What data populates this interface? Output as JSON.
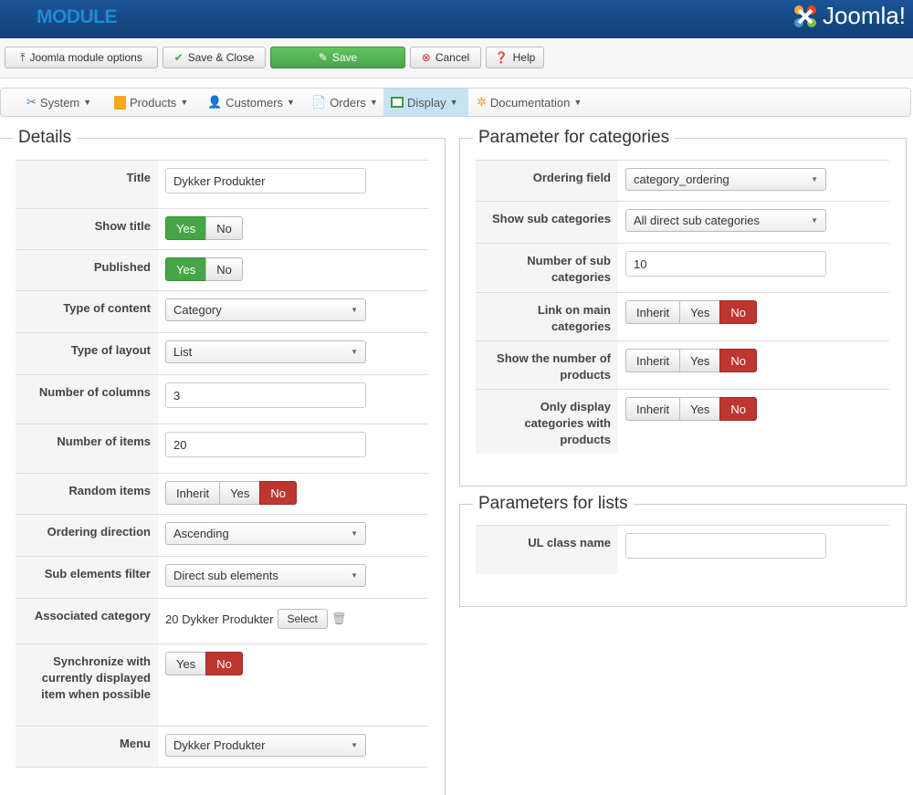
{
  "header": {
    "title": "MODULE",
    "logo": "Joomla!"
  },
  "toolbar": {
    "options": "Joomla module options",
    "save_close": "Save & Close",
    "save": "Save",
    "cancel": "Cancel",
    "help": "Help"
  },
  "menu": [
    {
      "label": "System",
      "icon": "tools-icon"
    },
    {
      "label": "Products",
      "icon": "box-icon"
    },
    {
      "label": "Customers",
      "icon": "users-icon"
    },
    {
      "label": "Orders",
      "icon": "document-icon"
    },
    {
      "label": "Display",
      "icon": "display-icon"
    },
    {
      "label": "Documentation",
      "icon": "help-ring-icon"
    }
  ],
  "details": {
    "legend": "Details",
    "title_label": "Title",
    "title_value": "Dykker Produkter",
    "show_title_label": "Show title",
    "published_label": "Published",
    "yes": "Yes",
    "no": "No",
    "inherit": "Inherit",
    "type_content_label": "Type of content",
    "type_content_value": "Category",
    "type_layout_label": "Type of layout",
    "type_layout_value": "List",
    "num_columns_label": "Number of columns",
    "num_columns_value": "3",
    "num_items_label": "Number of items",
    "num_items_value": "20",
    "random_label": "Random items",
    "ordering_dir_label": "Ordering direction",
    "ordering_dir_value": "Ascending",
    "sub_filter_label": "Sub elements filter",
    "sub_filter_value": "Direct sub elements",
    "assoc_label": "Associated category",
    "assoc_value": "20 Dykker Produkter",
    "select": "Select",
    "sync_label": "Synchronize with currently displayed item when possible",
    "menu_label": "Menu",
    "menu_value": "Dykker Produkter"
  },
  "categories": {
    "legend": "Parameter for categories",
    "ordering_label": "Ordering field",
    "ordering_value": "category_ordering",
    "show_sub_label": "Show sub categories",
    "show_sub_value": "All direct sub categories",
    "num_sub_label": "Number of sub categories",
    "num_sub_value": "10",
    "link_main_label": "Link on main categories",
    "show_num_label": "Show the number of products",
    "only_label": "Only display categories with products"
  },
  "lists": {
    "legend": "Parameters for lists",
    "ul_label": "UL class name",
    "ul_value": ""
  }
}
